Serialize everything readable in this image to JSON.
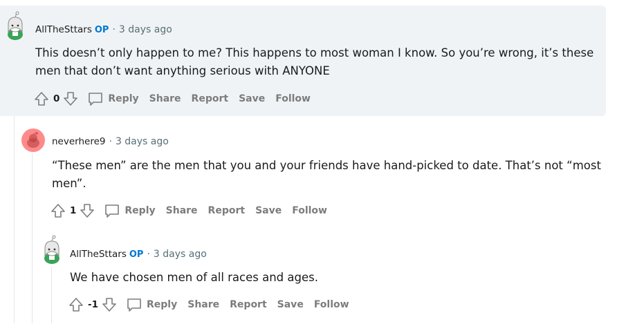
{
  "comments": [
    {
      "author": "AllTheSttars",
      "op_badge": "OP",
      "separator": "·",
      "time": "3 days ago",
      "body": "This doesn’t only happen to me? This happens to most woman I know. So you’re wrong, it’s these men that don’t want anything serious with ANYONE",
      "votes": "0",
      "actions": {
        "reply": "Reply",
        "share": "Share",
        "report": "Report",
        "save": "Save",
        "follow": "Follow"
      },
      "highlighted": true
    },
    {
      "author": "neverhere9",
      "separator": "·",
      "time": "3 days ago",
      "body": "“These men” are the men that you and your friends have hand-picked to date. That’s not “most men”.",
      "votes": "1",
      "actions": {
        "reply": "Reply",
        "share": "Share",
        "report": "Report",
        "save": "Save",
        "follow": "Follow"
      }
    },
    {
      "author": "AllTheSttars",
      "op_badge": "OP",
      "separator": "·",
      "time": "3 days ago",
      "body": "We have chosen men of all races and ages.",
      "votes": "-1",
      "actions": {
        "reply": "Reply",
        "share": "Share",
        "report": "Report",
        "save": "Save",
        "follow": "Follow"
      }
    }
  ],
  "colors": {
    "highlight_bg": "#f0f3f6",
    "op_badge": "#0079d3",
    "meta_text": "#576f76",
    "action_text": "#7c7c7c",
    "thread_line": "#e3e5e8",
    "snoo_avatar_bg": "#ff8a8a"
  },
  "icons": [
    "user-avatar-icon",
    "snoo-avatar-icon",
    "upvote-icon",
    "downvote-icon",
    "comment-bubble-icon"
  ]
}
